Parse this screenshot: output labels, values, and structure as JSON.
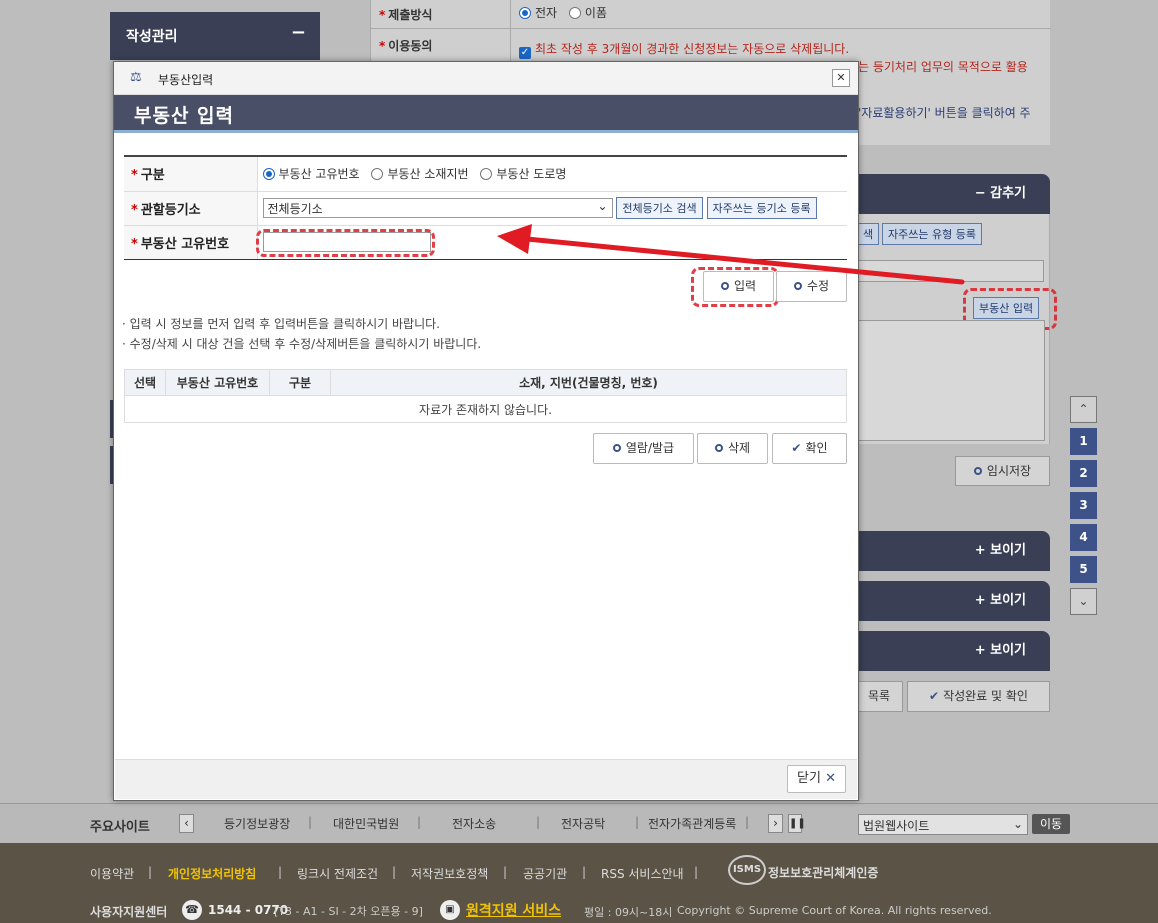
{
  "background": {
    "sidebar_title": "작성관리",
    "sidebar_toggle": "−",
    "submit_method_label": "제출방식",
    "submit_options": [
      "전자",
      "이폼"
    ],
    "consent_label": "이용동의",
    "consent_line1": "최초 작성 후 3개월이 경과한 신청정보는 자동으로 삭제됩니다.",
    "consent_line2": "는 등기처리 업무의 목적으로 활용",
    "consent_line3": "'자료활용하기' 버튼을 클릭하여 주",
    "panel_hide": "− 감추기",
    "search_btn_partial": "색",
    "favorite_type_btn": "자주쓰는 유형 등록",
    "realestate_input_btn": "부동산 입력",
    "temp_save_btn": "임시저장",
    "show_labels": [
      "+ 보이기",
      "+ 보이기",
      "+ 보이기"
    ],
    "list_btn": "목록",
    "complete_btn": "작성완료 및 확인",
    "pager": [
      "1",
      "2",
      "3",
      "4",
      "5"
    ],
    "pager_up": "⌃",
    "pager_down": "⌄"
  },
  "modal": {
    "window_title": "부동산입력",
    "close_x": "✕",
    "header": "부동산 입력",
    "fields": {
      "type_label": "구분",
      "type_options": [
        "부동산 고유번호",
        "부동산 소재지번",
        "부동산 도로명"
      ],
      "registry_label": "관할등기소",
      "registry_value": "전체등기소",
      "registry_search_btn": "전체등기소 검색",
      "registry_fav_btn": "자주쓰는 등기소 등록",
      "unique_no_label": "부동산 고유번호",
      "unique_no_value": ""
    },
    "input_btn": "입력",
    "edit_btn": "수정",
    "notes": [
      "입력 시 정보를 먼저 입력 후 입력버튼을 클릭하시기 바랍니다.",
      "수정/삭제 시 대상 건을 선택 후 수정/삭제버튼을 클릭하시기 바랍니다."
    ],
    "table_headers": [
      "선택",
      "부동산 고유번호",
      "구분",
      "소재, 지번(건물명칭, 번호)"
    ],
    "table_empty": "자료가 존재하지 않습니다.",
    "view_issue_btn": "열람/발급",
    "delete_btn": "삭제",
    "confirm_btn": "확인",
    "close_btn": "닫기"
  },
  "footer": {
    "sites_label": "주요사이트",
    "sites": [
      "등기정보광장",
      "대한민국법원",
      "전자소송",
      "전자공탁",
      "전자가족관계등록"
    ],
    "site_select": "법원웹사이트",
    "go_btn": "이동",
    "links": [
      "이용약관",
      "개인정보처리방침",
      "링크시 전제조건",
      "저작권보호정책",
      "공공기관",
      "RSS 서비스안내"
    ],
    "isms": "정보보호관리체계인증",
    "support_label": "사용자지원센터",
    "phone": "1544 - 0770",
    "phone_detail": "[T3 - A1 - SI - 2차 오픈용 - 9]",
    "remote": "원격지원 서비스",
    "hours": "평일 : 09시~18시",
    "copyright": "Copyright © Supreme Court of Korea. All rights reserved."
  },
  "colors": {
    "header_navy": "#494f66",
    "accent_blue": "#1a66c6",
    "highlight_red": "#dc1e28"
  }
}
